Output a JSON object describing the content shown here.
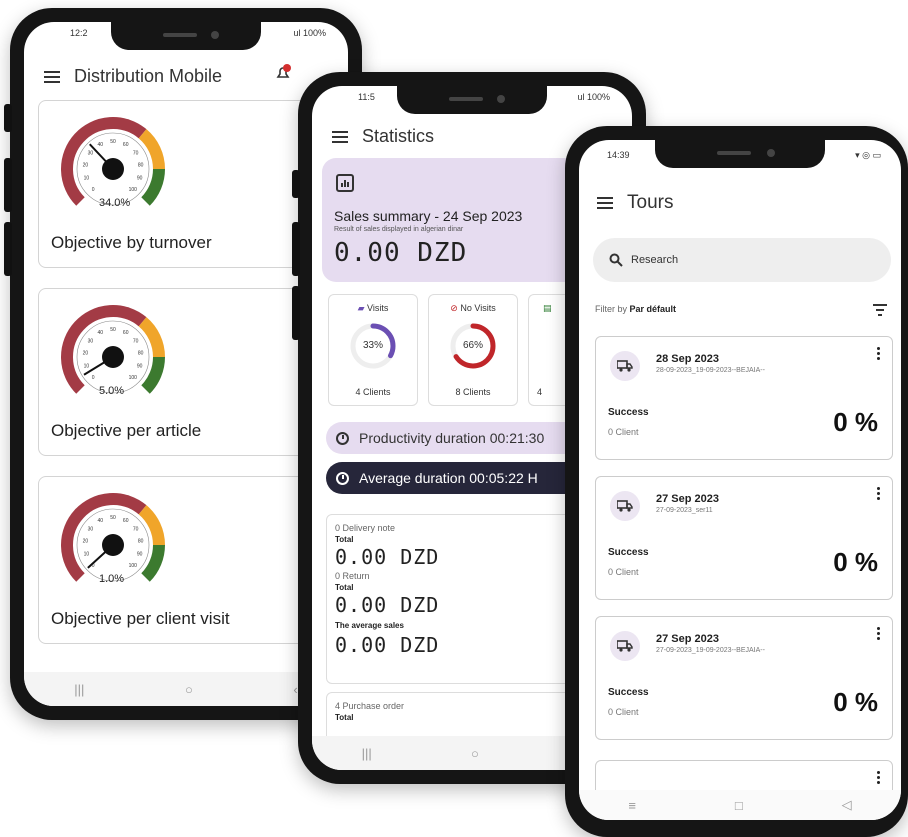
{
  "phone1": {
    "status_time": "12:2",
    "status_battery": "ul 100%",
    "title": "Distribution Mobile",
    "cards": [
      {
        "label": "Objective by turnover",
        "value": "34.0%",
        "fraction": 0.34
      },
      {
        "label": "Objective per article",
        "value": "5.0%",
        "fraction": 0.05
      },
      {
        "label": "Objective per client visit",
        "value": "1.0%",
        "fraction": 0.01
      }
    ],
    "gauge_ticks": [
      "0",
      "10",
      "20",
      "30",
      "40",
      "50",
      "60",
      "70",
      "80",
      "90",
      "100"
    ]
  },
  "phone2": {
    "status_time": "11:5",
    "status_battery": "ul 100%",
    "title": "Statistics",
    "summary": {
      "title": "Sales summary - 24 Sep 2023",
      "subtitle": "Result of sales displayed in algerian dinar",
      "amount": "0.00 DZD"
    },
    "visits": {
      "label": "Visits",
      "percent": "33%",
      "clients": "4 Clients",
      "fraction": 0.33
    },
    "no_visits": {
      "label": "No Visits",
      "percent": "66%",
      "clients": "8 Clients",
      "fraction": 0.66
    },
    "third": {
      "clients": "4"
    },
    "productivity": "Productivity duration 00:21:30",
    "average": "Average duration 00:05:22 H",
    "sales": {
      "delivery_note": "0 Delivery note",
      "total1": "Total",
      "amount1": "0.00 DZD",
      "return": "0 Return",
      "total2": "Total",
      "amount2": "0.00 DZD",
      "avg_label": "The average sales",
      "amount3": "0.00 DZD"
    },
    "purchase": {
      "label": "4 Purchase order",
      "total": "Total"
    }
  },
  "phone3": {
    "status_time": "14:39",
    "title": "Tours",
    "search_placeholder": "Research",
    "filter_prefix": "Filter by",
    "filter_value": "Par défault",
    "tours": [
      {
        "date": "28 Sep 2023",
        "code": "28-09-2023_19-09-2023--BEJAIA--",
        "status": "Success",
        "clients": "0 Client",
        "percent": "0 %"
      },
      {
        "date": "27 Sep 2023",
        "code": "27-09-2023_ser11",
        "status": "Success",
        "clients": "0 Client",
        "percent": "0 %"
      },
      {
        "date": "27 Sep 2023",
        "code": "27-09-2023_19-09-2023--BEJAIA--",
        "status": "Success",
        "clients": "0 Client",
        "percent": "0 %"
      }
    ]
  },
  "colors": {
    "gauge_red": "#a33b45",
    "gauge_orange": "#f0a52a",
    "gauge_green": "#3c7a2f",
    "accent_purple": "#e6dcf0",
    "dark_pill": "#26263a",
    "visits_ring": "#6b4fb3",
    "novisits_ring": "#c0262a"
  }
}
